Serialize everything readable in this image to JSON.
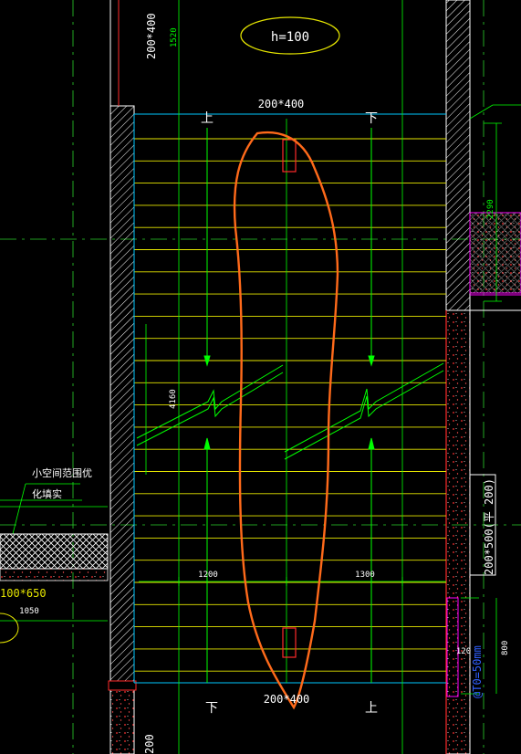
{
  "colors": {
    "background": "#000000",
    "wall_white": "#ffffff",
    "dim_green": "#00ff00",
    "axis_green": "#2bd02b",
    "tread_yellow": "#e6e600",
    "cyan": "#00c8ff",
    "red": "#ff2a2a",
    "orange_markup": "#ff6a1a",
    "magenta": "#ff00ff",
    "blue": "#3060ff"
  },
  "labels": {
    "cloud_note": "h=100",
    "beam_top_left_v": "200*400",
    "dim_1520": "1520",
    "beam_top": "200*400",
    "beam_bottom": "200*400",
    "up_top": "上",
    "down_top": "下",
    "down_bottom": "下",
    "up_bottom": "上",
    "dim_4160": "4160",
    "dim_1200": "1200",
    "dim_1300": "1300",
    "dim_2290": "2290",
    "beam_right_v": "200*500(平 200)",
    "dim_800": "800",
    "dim_120": "120",
    "pipe_note_v": "@T0=50mm",
    "note_line1": "小空间范围优",
    "note_line2": "化填实",
    "beam_left": "100*650",
    "dim_1050": "1050",
    "dim_bottom_left": "200"
  }
}
